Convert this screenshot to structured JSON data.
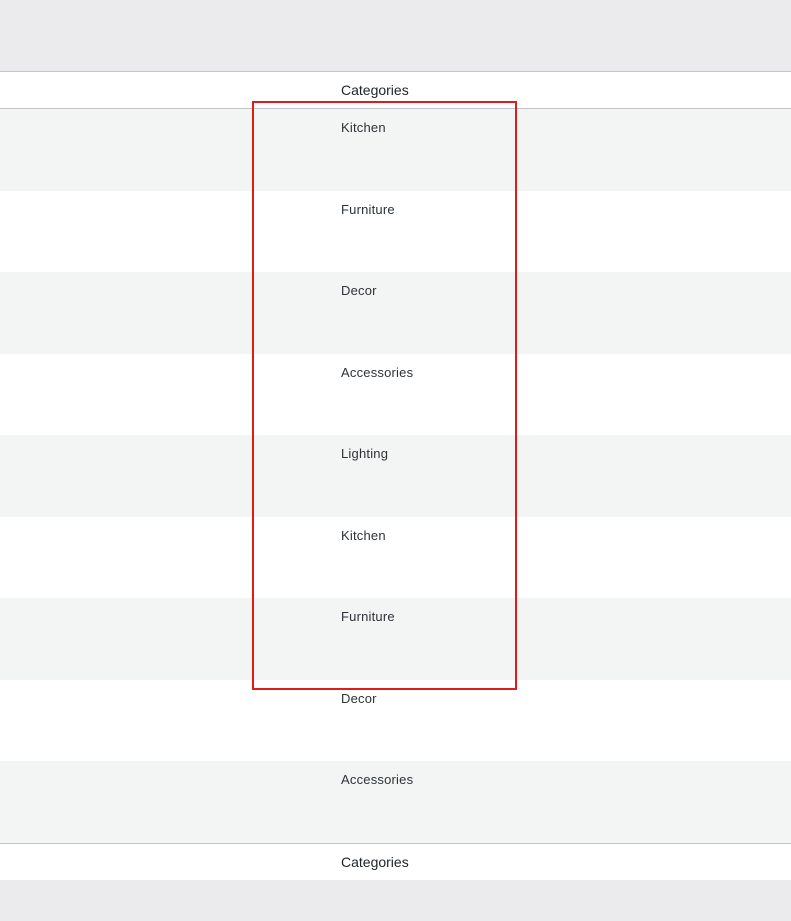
{
  "table": {
    "column_header": "Categories",
    "column_footer": "Categories",
    "rows": [
      {
        "category": "Kitchen"
      },
      {
        "category": "Furniture"
      },
      {
        "category": "Decor"
      },
      {
        "category": "Accessories"
      },
      {
        "category": "Lighting"
      },
      {
        "category": "Kitchen"
      },
      {
        "category": "Furniture"
      },
      {
        "category": "Decor"
      },
      {
        "category": "Accessories"
      }
    ]
  },
  "colors": {
    "highlight": "#e01b1b",
    "row_alt": "#f3f4f4",
    "row": "#ffffff",
    "chrome": "#ebebed"
  }
}
